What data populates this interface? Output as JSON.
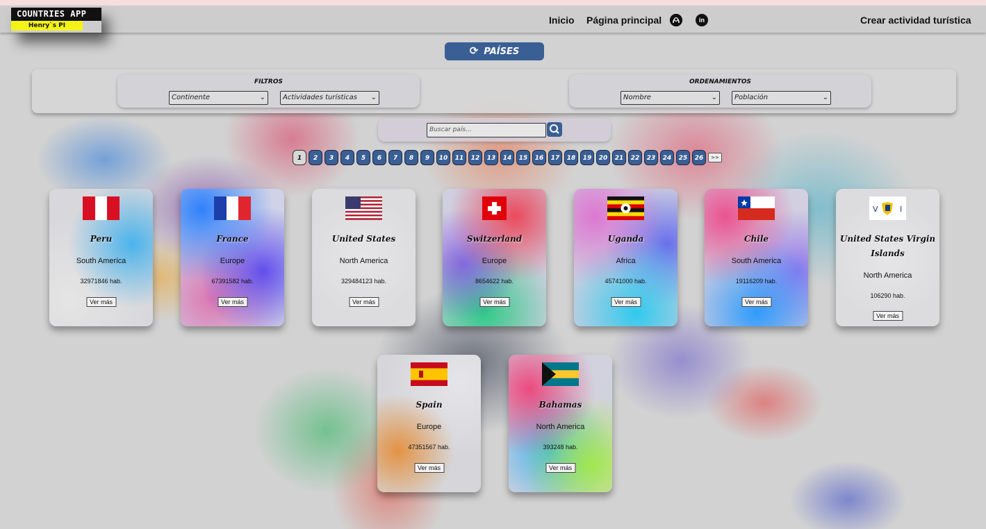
{
  "nav": {
    "logo_title": "COUNTRIES APP",
    "logo_sub": "Henry`s PI",
    "links": [
      "Inicio",
      "Página principal"
    ],
    "github_icon": "github-icon",
    "linkedin_icon": "linkedin-icon",
    "linkedin_glyph": "in",
    "create_activity": "Crear actividad turística"
  },
  "paises_button": {
    "label": "PAÍSES",
    "icon": "refresh-icon"
  },
  "filters": {
    "title": "FILTROS",
    "continent": "Continente",
    "activities": "Actividades turísticas"
  },
  "sorting": {
    "title": "ORDENAMIENTOS",
    "name": "Nombre",
    "population": "Población"
  },
  "search": {
    "placeholder": "Buscar país...",
    "icon": "search-icon"
  },
  "pagination": {
    "pages": [
      "1",
      "2",
      "3",
      "4",
      "5",
      "6",
      "7",
      "8",
      "9",
      "10",
      "11",
      "12",
      "13",
      "14",
      "15",
      "16",
      "17",
      "18",
      "19",
      "20",
      "21",
      "22",
      "23",
      "24",
      "25",
      "26"
    ],
    "current": "1",
    "next_label": ">>"
  },
  "countries": [
    {
      "name": "Peru",
      "continent": "South America",
      "population": "32971846 hab.",
      "button": "Ver más",
      "flag": "peru"
    },
    {
      "name": "France",
      "continent": "Europe",
      "population": "67391582 hab.",
      "button": "Ver más",
      "flag": "france"
    },
    {
      "name": "United States",
      "continent": "North America",
      "population": "329484123 hab.",
      "button": "Ver más",
      "flag": "usa"
    },
    {
      "name": "Switzerland",
      "continent": "Europe",
      "population": "8654622 hab.",
      "button": "Ver más",
      "flag": "switzerland"
    },
    {
      "name": "Uganda",
      "continent": "Africa",
      "population": "45741000 hab.",
      "button": "Ver más",
      "flag": "uganda"
    },
    {
      "name": "Chile",
      "continent": "South America",
      "population": "19116209 hab.",
      "button": "Ver más",
      "flag": "chile"
    },
    {
      "name": "United States Virgin Islands",
      "continent": "North America",
      "population": "106290 hab.",
      "button": "Ver más",
      "flag": "usvi"
    },
    {
      "name": "Spain",
      "continent": "Europe",
      "population": "47351567 hab.",
      "button": "Ver más",
      "flag": "spain"
    },
    {
      "name": "Bahamas",
      "continent": "North America",
      "population": "393248 hab.",
      "button": "Ver más",
      "flag": "bahamas"
    }
  ],
  "colors": {
    "accent": "#3a5f94",
    "logo_yellow": "#f3f317"
  }
}
